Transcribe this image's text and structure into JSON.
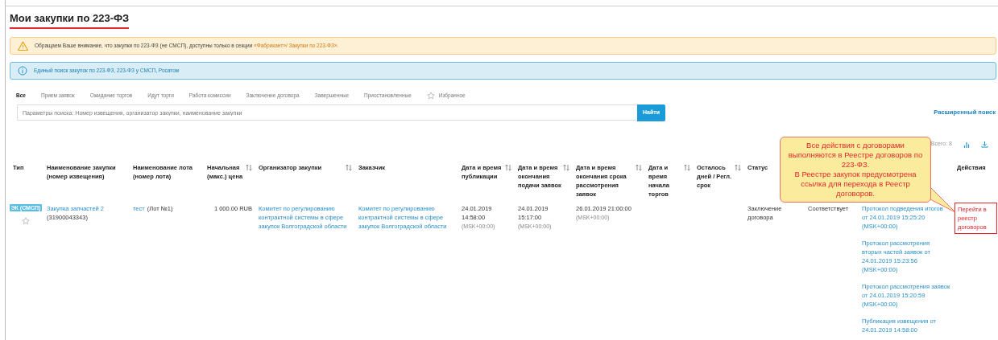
{
  "page": {
    "title": "Мои закупки по 223-ФЗ"
  },
  "warning": {
    "text": "Обращаем Ваше внимание, что закупки по 223-ФЗ (не СМСП), доступны только в секции ",
    "link": "«Фабрикант»/ Закупки по 223-ФЗ»."
  },
  "info": {
    "link": "Единый поиск закупок по 223-ФЗ, 223-ФЗ у СМСП, Росатом"
  },
  "tabs": [
    {
      "label": "Все",
      "selected": true,
      "kind": "plain"
    },
    {
      "label": "Прием заявок",
      "selected": false,
      "kind": "plain"
    },
    {
      "label": "Ожидание торгов",
      "selected": false,
      "kind": "plain"
    },
    {
      "label": "Идут торги",
      "selected": false,
      "kind": "plain"
    },
    {
      "label": "Работа комиссии",
      "selected": false,
      "kind": "plain"
    },
    {
      "label": "Заключение договора",
      "selected": false,
      "kind": "plain"
    },
    {
      "label": "Завершенные",
      "selected": false,
      "kind": "plain"
    },
    {
      "label": "Приостановленные",
      "selected": false,
      "kind": "plain"
    },
    {
      "label": "Избранное",
      "selected": false,
      "kind": "favorite"
    }
  ],
  "search": {
    "placeholder": "Параметры поиска: Номер извещения, организатор закупки, наименование закупки",
    "button": "Найти",
    "advanced_link": "Расширенный поиск"
  },
  "table": {
    "total": "Всего: 8",
    "columns": [
      {
        "label": "Тип",
        "sortable": false
      },
      {
        "label": "Наименование закупки (номер извещения)",
        "sortable": false
      },
      {
        "label": "Наименование лота (номер лота)",
        "sortable": false
      },
      {
        "label": "Начальная (макс.) цена",
        "sortable": true
      },
      {
        "label": "Организатор закупки",
        "sortable": true
      },
      {
        "label": "Заказчик",
        "sortable": false
      },
      {
        "label": "Дата и время публикации",
        "sortable": true
      },
      {
        "label": "Дата и время окончания подачи заявок",
        "sortable": true
      },
      {
        "label": "Дата и время окончания срока рассмотрения заявок",
        "sortable": true
      },
      {
        "label": "Дата и время начала торгов",
        "sortable": true
      },
      {
        "label": "Осталось дней / Регл. срок",
        "sortable": true
      },
      {
        "label": "Статус"
      },
      {
        "label": "Действия",
        "sortable": false
      }
    ],
    "rows": [
      {
        "type_badge": "ЭК (СМСП)",
        "favorite": false,
        "name": "Закупка запчастей 2",
        "number": "(31900043343)",
        "lot": "тест",
        "lot_number": "(Лот №1)",
        "price": "1 000.00 RUB",
        "organizer": "Комитет по регулированию контрактной системы в сфере закупок Волгоградской области",
        "customer": "Комитет по регулированию контрактной системы в сфере закупок Волгоградской области",
        "published": {
          "datetime": "24.01.2019 14:58:00",
          "tz": "(MSK+00:00)"
        },
        "submission_end": {
          "datetime": "24.01.2019 15:17:00",
          "tz": "(MSK+00:00)"
        },
        "review_end": {
          "datetime": "26.01.2019 21:00:00",
          "tz": "(MSK+00:00)"
        },
        "status": "Заключение договора",
        "column_13": "Соответствует",
        "documents": [
          "Протокол подведения итогов от 24.01.2019 15:25:20 (MSK+00:00)",
          "Протокол рассмотрения вторых частей заявок от 24.01.2019 15:23:56 (MSK+00:00)",
          "Протокол рассмотрения заявок от 24.01.2019 15:20:59 (MSK+00:00)",
          "Публикация извещения от 24.01.2019 14:58:00"
        ],
        "action": "Перейти в реестр договоров"
      }
    ]
  },
  "callout": {
    "paragraphs": [
      "Все действия с договорами выполняются в Реестре договоров по 223-ФЗ.",
      "В Реестре закупок предусмотрена ссылка для перехода в Реестр договоров."
    ]
  }
}
